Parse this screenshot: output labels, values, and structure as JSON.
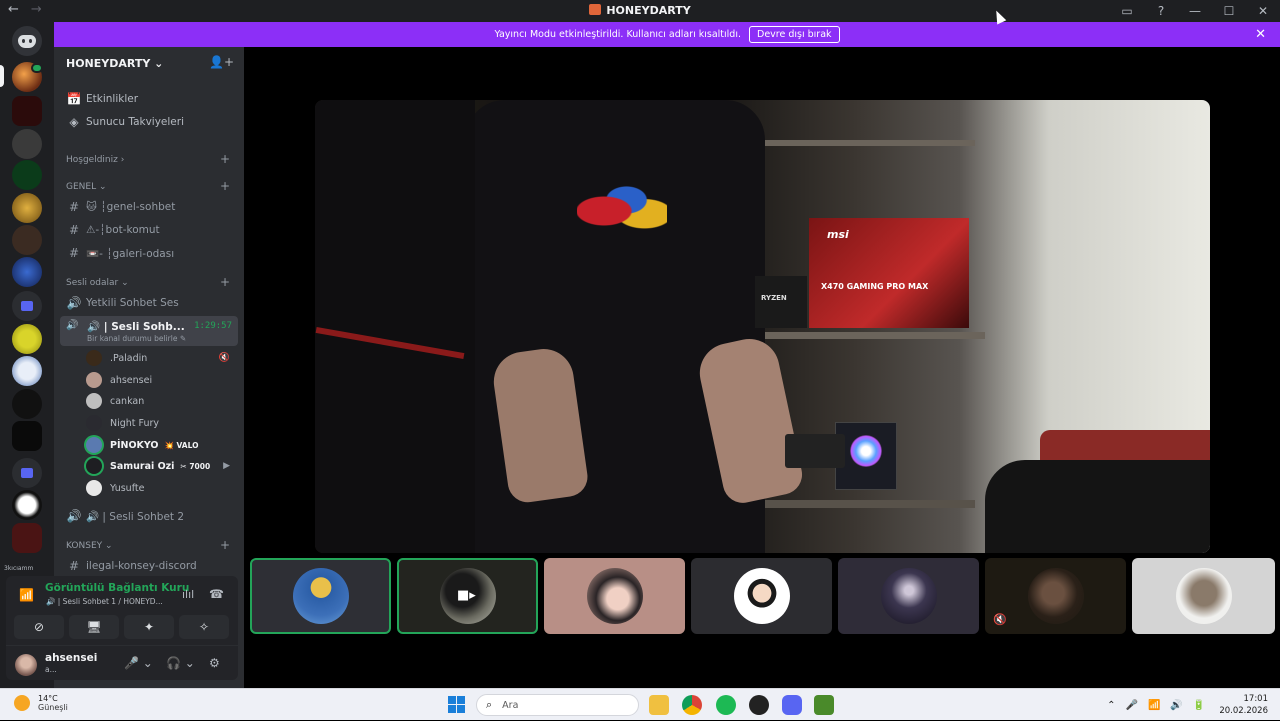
{
  "titlebar": {
    "back": "←",
    "forward": "→",
    "title": "HONEYDARTY",
    "inbox": "▭",
    "help": "?",
    "minimize": "—",
    "maximize": "☐",
    "close": "✕"
  },
  "notice": {
    "text": "Yayıncı Modu etkinleştirildi. Kullanıcı adları kısaltıldı.",
    "button": "Devre dışı bırak",
    "close": "✕"
  },
  "server": {
    "name": "HONEYDARTY ⌄",
    "invite_icon": "👤+",
    "top_links": [
      {
        "icon": "📅",
        "label": "Etkinlikler"
      },
      {
        "icon": "◈",
        "label": "Sunucu Takviyeleri"
      }
    ],
    "categories": [
      {
        "label": "Hoşgeldiniz ›"
      },
      {
        "label": "GENEL ⌄"
      },
      {
        "label": "Sesli odalar ⌄"
      },
      {
        "label": "KONSEY ⌄"
      }
    ],
    "text_channels": [
      {
        "icon": "#",
        "label": "🐱 ┆genel-sohbet"
      },
      {
        "icon": "#",
        "label": "⚠-┆bot-komut"
      },
      {
        "icon": "#",
        "label": "📼- ┆galeri-odası"
      }
    ],
    "voice_channels": [
      {
        "icon": "🔊",
        "label": "Yetkili Sohbet Ses"
      },
      {
        "icon": "🔊",
        "label": "🔊 | Sesli Sohbet 2"
      }
    ],
    "active_voice": {
      "name": "🔊 | Sesli Sohb...",
      "timer": "1:29:57",
      "status": "Bir kanal durumu belirle ✎"
    },
    "voice_users": [
      {
        "name": ".Paladin",
        "bold": false,
        "tag": "",
        "right": "🔇"
      },
      {
        "name": "ahsensei",
        "bold": false,
        "tag": "",
        "right": ""
      },
      {
        "name": "cankan",
        "bold": false,
        "tag": "",
        "right": ""
      },
      {
        "name": "Night Fury",
        "bold": false,
        "tag": "",
        "right": ""
      },
      {
        "name": "PİNOKYO",
        "bold": true,
        "tag": "💥 VALO",
        "right": ""
      },
      {
        "name": "Samurai Ozi",
        "bold": true,
        "tag": "✂ 7000",
        "right": "▶"
      },
      {
        "name": "Yusufte",
        "bold": false,
        "tag": "",
        "right": ""
      }
    ],
    "konsey_channel": {
      "icon": "#",
      "label": "ilegal-konsey-discord"
    }
  },
  "guild_label": "3kıcıamm",
  "rtc": {
    "title": "Görüntülü Bağlantı Kuru",
    "subtitle": "🔊 | Sesli Sohbet 1 / HONEYD...",
    "signal_icon": "📶",
    "wave_icon": "ılıl",
    "hangup_icon": "☎",
    "buttons": [
      "⊘",
      "🖥",
      "✦",
      "✧"
    ]
  },
  "me": {
    "name": "ahsensei",
    "sub": "a...",
    "mic": "🎤 ⌄",
    "headset": "🎧 ⌄",
    "settings": "⚙"
  },
  "video": {
    "brand_text": "msi",
    "board_text": "X470 GAMING PRO MAX",
    "cpu_text": "RYZEN"
  },
  "tiles": {
    "camera_icon": "■▸",
    "muted_icon": "🔇"
  },
  "taskbar": {
    "temp": "14°C",
    "weather": "Güneşli",
    "search": "Ara",
    "search_icon": "⌕",
    "chevron": "⌃",
    "mic": "🎤",
    "wifi": "📶",
    "volume": "🔊",
    "battery": "🔋",
    "time": "17:01",
    "date": "20.02.2026"
  },
  "colors": {
    "notice_bg": "#8c2ff7",
    "speaking": "#23a559",
    "sidebar": "#2b2d31",
    "guild_bar": "#1e1f22"
  }
}
